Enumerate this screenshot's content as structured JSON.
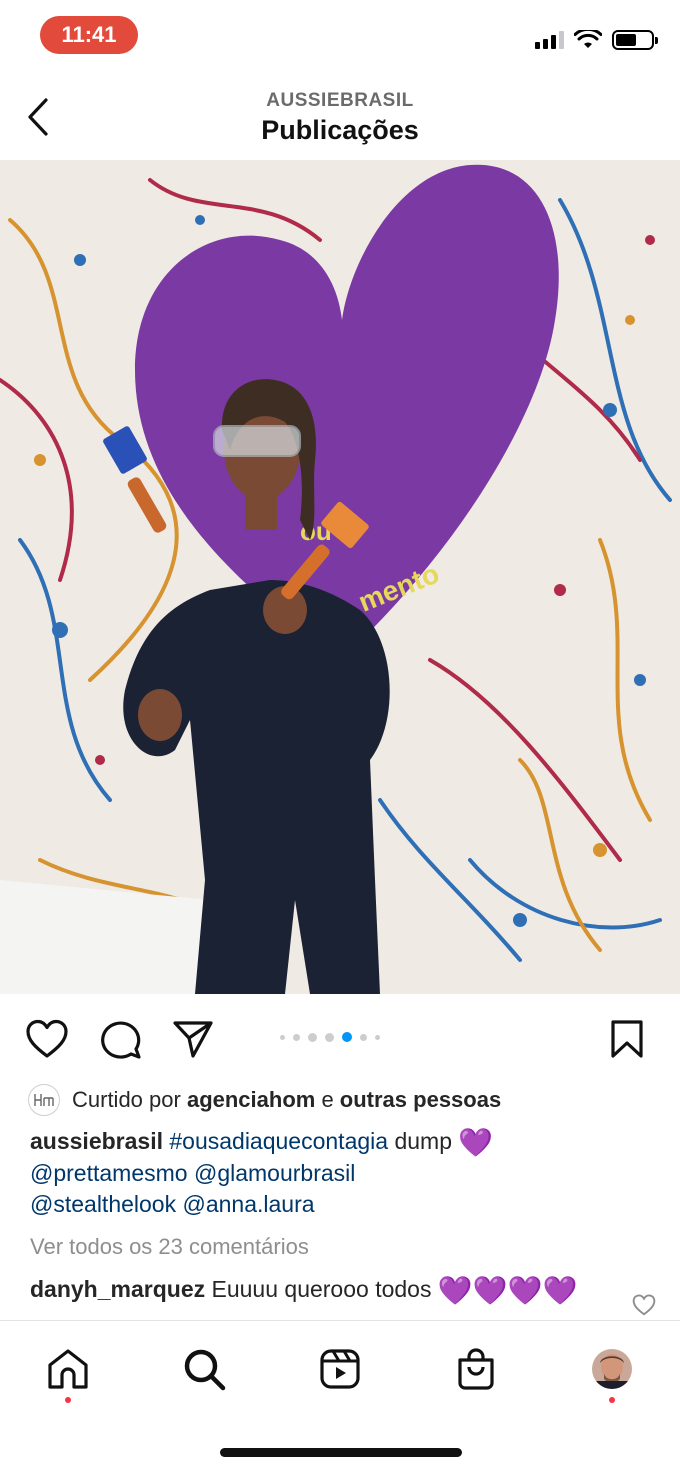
{
  "status_bar": {
    "time": "11:41",
    "icons": [
      "signal-icon",
      "wifi-icon",
      "battery-icon"
    ]
  },
  "header": {
    "back_icon": "chevron-left-icon",
    "subtitle": "AUSSIEBRASIL",
    "title": "Publicações"
  },
  "post": {
    "image_text": "ou\nmento",
    "carousel": {
      "count": 7,
      "active_index": 4
    },
    "actions": [
      "heart-icon",
      "comment-icon",
      "share-icon",
      "bookmark-icon"
    ],
    "likes": {
      "prefix": "Curtido por ",
      "user": "agenciahom",
      "connector": " e ",
      "others": "outras pessoas"
    },
    "caption": {
      "user": "aussiebrasil",
      "hashtag": "#ousadiaquecontagia",
      "text": " dump ",
      "emoji": "💜",
      "mentions": [
        "@prettamesmo",
        "@glamourbrasil",
        "@stealthelook",
        "@anna.laura"
      ]
    },
    "view_comments": "Ver todos os 23 comentários",
    "top_comment": {
      "user": "danyh_marquez",
      "text": " Euuuu querooo todos ",
      "emojis": "💜💜💜💜"
    }
  },
  "tab_bar": {
    "items": [
      "home-icon",
      "search-icon",
      "reels-icon",
      "shop-icon",
      "profile-avatar"
    ]
  },
  "colors": {
    "status_pill": "#e24a3b",
    "link": "#00376b",
    "active_dot": "#0095f6",
    "notification_dot": "#ff3040",
    "heart_wall": "#7b3aa3"
  }
}
